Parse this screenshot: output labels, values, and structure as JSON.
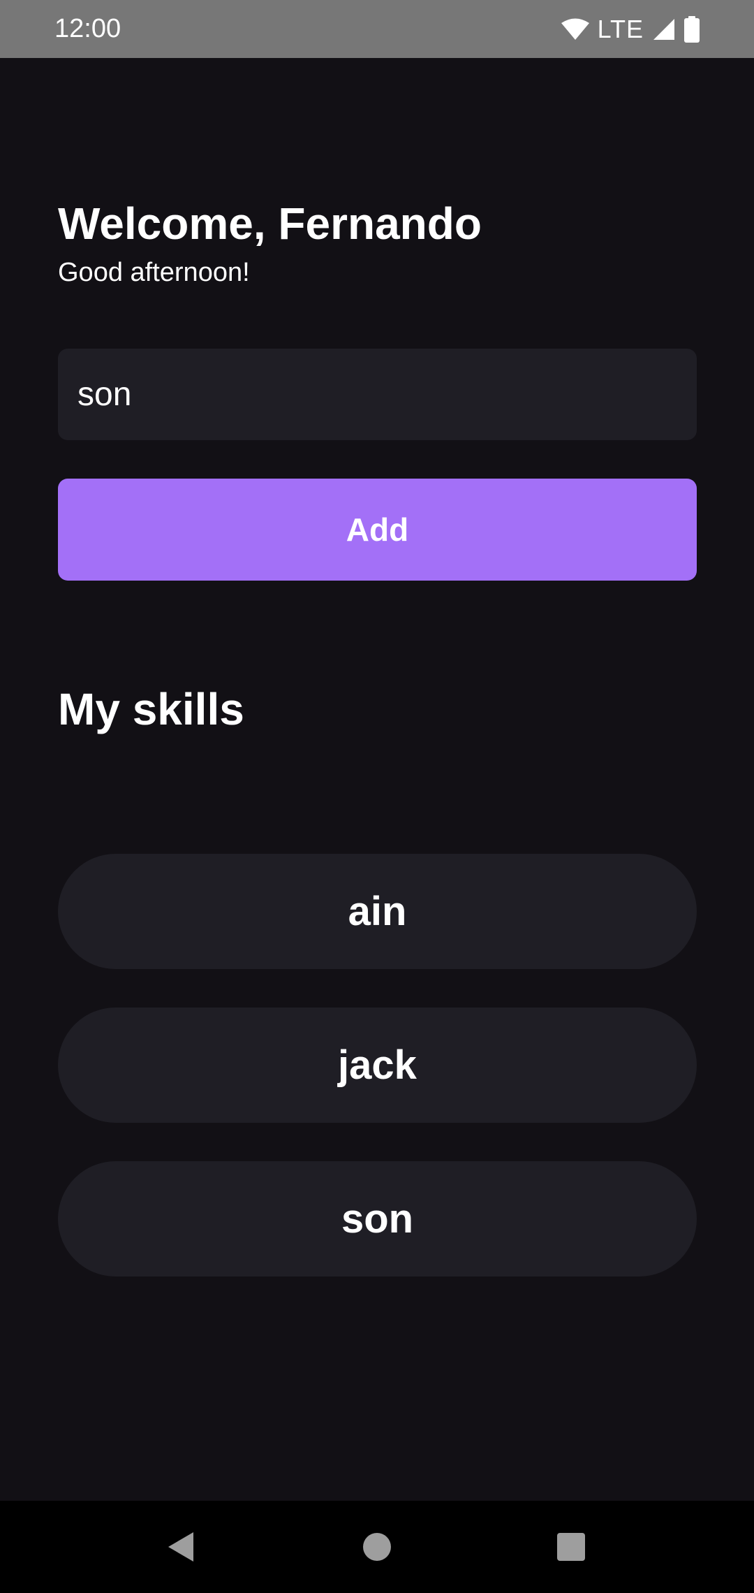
{
  "status_bar": {
    "time": "12:00",
    "network": "LTE",
    "icons": [
      "wifi-icon",
      "signal-icon",
      "battery-icon"
    ]
  },
  "greeting": {
    "title": "Welcome, Fernando",
    "subtitle": "Good afternoon!"
  },
  "new_skill_input": {
    "value": "son"
  },
  "add_button": {
    "label": "Add"
  },
  "skills_section": {
    "title": "My skills",
    "items": [
      {
        "label": "ain"
      },
      {
        "label": "jack"
      },
      {
        "label": "son"
      }
    ]
  },
  "navigation": {
    "icons": [
      "back-icon",
      "home-icon",
      "recents-icon"
    ]
  },
  "colors": {
    "background": "#121015",
    "card": "#1f1e25",
    "accent": "#a370f7",
    "status_bar": "#777777",
    "nav_bar": "#000000",
    "text": "#ffffff"
  }
}
